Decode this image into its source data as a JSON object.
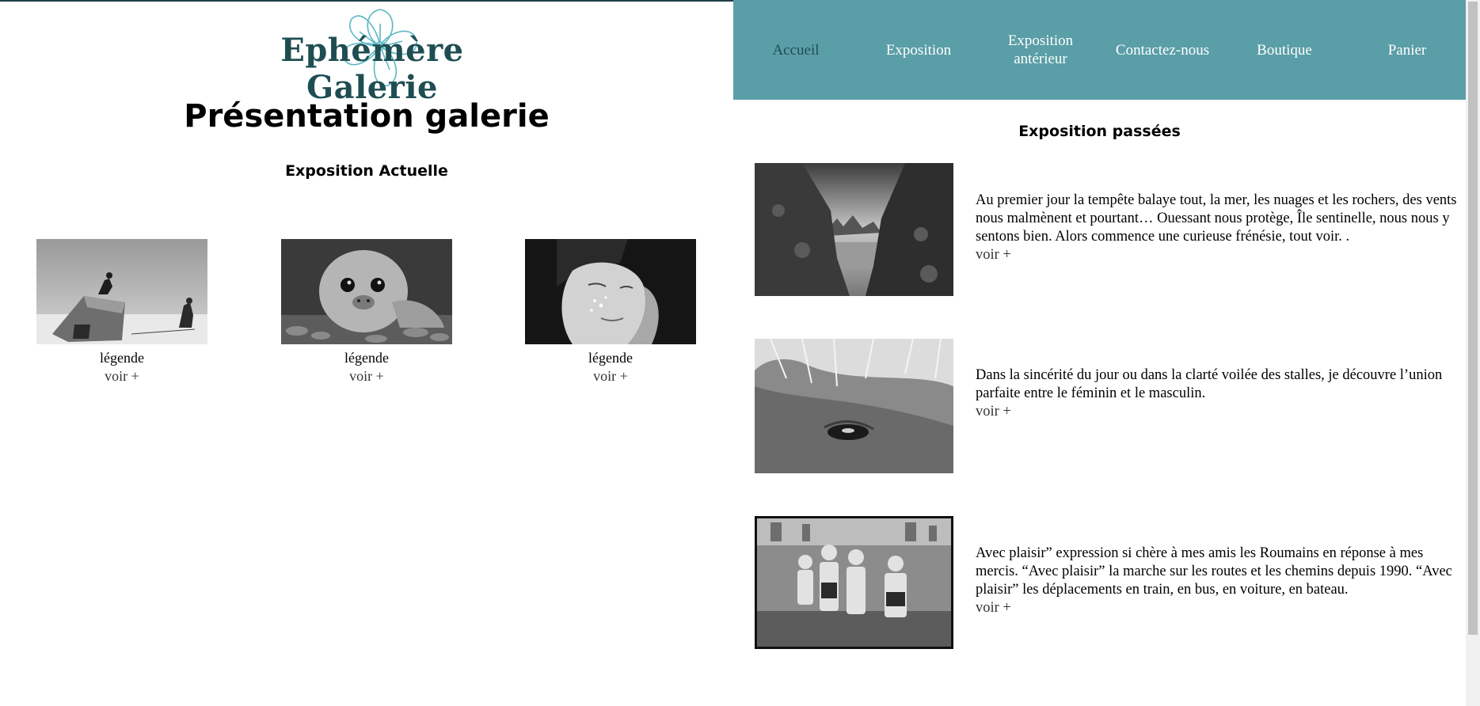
{
  "brand": {
    "logo_text": "Ephémère Galerie",
    "color": "#1f4e52",
    "flower_color": "#5ab8c4"
  },
  "nav": {
    "background": "#5a9ea7",
    "items": [
      {
        "label": "Accueil",
        "active": true
      },
      {
        "label": "Exposition"
      },
      {
        "label": "Exposition antérieur"
      },
      {
        "label": "Contactez-nous"
      },
      {
        "label": "Boutique"
      },
      {
        "label": "Panier"
      }
    ]
  },
  "main": {
    "title": "Présentation galerie",
    "current": {
      "heading": "Exposition Actuelle",
      "cards": [
        {
          "caption": "légende",
          "more": "voir +",
          "image_icon": "photo-bunker-climber-icon"
        },
        {
          "caption": "légende",
          "more": "voir +",
          "image_icon": "photo-seal-icon"
        },
        {
          "caption": "légende",
          "more": "voir +",
          "image_icon": "photo-woman-face-icon"
        }
      ]
    }
  },
  "past": {
    "heading": "Exposition passées",
    "items": [
      {
        "text": "Au premier jour la tempête balaye tout, la mer, les nuages et les rochers, des vents nous malmènent et pourtant… Ouessant nous protège, Île sentinelle, nous nous y sentons bien. Alors commence une curieuse frénésie, tout voir. .",
        "more": "voir +",
        "image_icon": "photo-rocks-sea-icon"
      },
      {
        "text": "Dans la sincérité du jour ou dans la clarté voilée des stalles, je découvre l’union parfaite entre le féminin et le masculin.",
        "more": "voir +",
        "image_icon": "photo-horse-eye-icon"
      },
      {
        "text": "Avec plaisir” expression si chère à mes amis les Roumains en réponse à mes mercis. “Avec plaisir” la marche sur les routes et les chemins depuis 1990. “Avec plaisir” les déplacements en train, en bus, en voiture, en bateau.",
        "more": "voir +",
        "image_icon": "photo-children-fountain-icon"
      }
    ]
  }
}
